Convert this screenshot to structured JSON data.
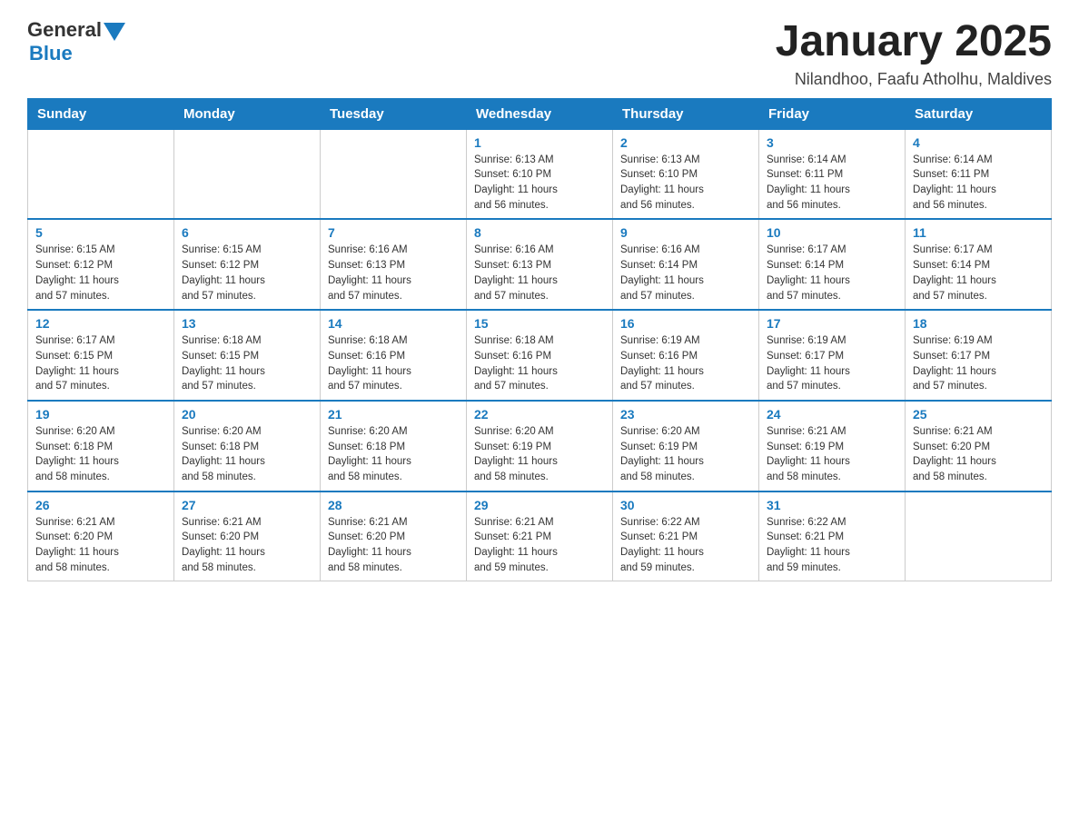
{
  "header": {
    "logo_general": "General",
    "logo_blue": "Blue",
    "month_title": "January 2025",
    "subtitle": "Nilandhoo, Faafu Atholhu, Maldives"
  },
  "days_of_week": [
    "Sunday",
    "Monday",
    "Tuesday",
    "Wednesday",
    "Thursday",
    "Friday",
    "Saturday"
  ],
  "weeks": [
    {
      "days": [
        {
          "num": "",
          "info": ""
        },
        {
          "num": "",
          "info": ""
        },
        {
          "num": "",
          "info": ""
        },
        {
          "num": "1",
          "info": "Sunrise: 6:13 AM\nSunset: 6:10 PM\nDaylight: 11 hours\nand 56 minutes."
        },
        {
          "num": "2",
          "info": "Sunrise: 6:13 AM\nSunset: 6:10 PM\nDaylight: 11 hours\nand 56 minutes."
        },
        {
          "num": "3",
          "info": "Sunrise: 6:14 AM\nSunset: 6:11 PM\nDaylight: 11 hours\nand 56 minutes."
        },
        {
          "num": "4",
          "info": "Sunrise: 6:14 AM\nSunset: 6:11 PM\nDaylight: 11 hours\nand 56 minutes."
        }
      ]
    },
    {
      "days": [
        {
          "num": "5",
          "info": "Sunrise: 6:15 AM\nSunset: 6:12 PM\nDaylight: 11 hours\nand 57 minutes."
        },
        {
          "num": "6",
          "info": "Sunrise: 6:15 AM\nSunset: 6:12 PM\nDaylight: 11 hours\nand 57 minutes."
        },
        {
          "num": "7",
          "info": "Sunrise: 6:16 AM\nSunset: 6:13 PM\nDaylight: 11 hours\nand 57 minutes."
        },
        {
          "num": "8",
          "info": "Sunrise: 6:16 AM\nSunset: 6:13 PM\nDaylight: 11 hours\nand 57 minutes."
        },
        {
          "num": "9",
          "info": "Sunrise: 6:16 AM\nSunset: 6:14 PM\nDaylight: 11 hours\nand 57 minutes."
        },
        {
          "num": "10",
          "info": "Sunrise: 6:17 AM\nSunset: 6:14 PM\nDaylight: 11 hours\nand 57 minutes."
        },
        {
          "num": "11",
          "info": "Sunrise: 6:17 AM\nSunset: 6:14 PM\nDaylight: 11 hours\nand 57 minutes."
        }
      ]
    },
    {
      "days": [
        {
          "num": "12",
          "info": "Sunrise: 6:17 AM\nSunset: 6:15 PM\nDaylight: 11 hours\nand 57 minutes."
        },
        {
          "num": "13",
          "info": "Sunrise: 6:18 AM\nSunset: 6:15 PM\nDaylight: 11 hours\nand 57 minutes."
        },
        {
          "num": "14",
          "info": "Sunrise: 6:18 AM\nSunset: 6:16 PM\nDaylight: 11 hours\nand 57 minutes."
        },
        {
          "num": "15",
          "info": "Sunrise: 6:18 AM\nSunset: 6:16 PM\nDaylight: 11 hours\nand 57 minutes."
        },
        {
          "num": "16",
          "info": "Sunrise: 6:19 AM\nSunset: 6:16 PM\nDaylight: 11 hours\nand 57 minutes."
        },
        {
          "num": "17",
          "info": "Sunrise: 6:19 AM\nSunset: 6:17 PM\nDaylight: 11 hours\nand 57 minutes."
        },
        {
          "num": "18",
          "info": "Sunrise: 6:19 AM\nSunset: 6:17 PM\nDaylight: 11 hours\nand 57 minutes."
        }
      ]
    },
    {
      "days": [
        {
          "num": "19",
          "info": "Sunrise: 6:20 AM\nSunset: 6:18 PM\nDaylight: 11 hours\nand 58 minutes."
        },
        {
          "num": "20",
          "info": "Sunrise: 6:20 AM\nSunset: 6:18 PM\nDaylight: 11 hours\nand 58 minutes."
        },
        {
          "num": "21",
          "info": "Sunrise: 6:20 AM\nSunset: 6:18 PM\nDaylight: 11 hours\nand 58 minutes."
        },
        {
          "num": "22",
          "info": "Sunrise: 6:20 AM\nSunset: 6:19 PM\nDaylight: 11 hours\nand 58 minutes."
        },
        {
          "num": "23",
          "info": "Sunrise: 6:20 AM\nSunset: 6:19 PM\nDaylight: 11 hours\nand 58 minutes."
        },
        {
          "num": "24",
          "info": "Sunrise: 6:21 AM\nSunset: 6:19 PM\nDaylight: 11 hours\nand 58 minutes."
        },
        {
          "num": "25",
          "info": "Sunrise: 6:21 AM\nSunset: 6:20 PM\nDaylight: 11 hours\nand 58 minutes."
        }
      ]
    },
    {
      "days": [
        {
          "num": "26",
          "info": "Sunrise: 6:21 AM\nSunset: 6:20 PM\nDaylight: 11 hours\nand 58 minutes."
        },
        {
          "num": "27",
          "info": "Sunrise: 6:21 AM\nSunset: 6:20 PM\nDaylight: 11 hours\nand 58 minutes."
        },
        {
          "num": "28",
          "info": "Sunrise: 6:21 AM\nSunset: 6:20 PM\nDaylight: 11 hours\nand 58 minutes."
        },
        {
          "num": "29",
          "info": "Sunrise: 6:21 AM\nSunset: 6:21 PM\nDaylight: 11 hours\nand 59 minutes."
        },
        {
          "num": "30",
          "info": "Sunrise: 6:22 AM\nSunset: 6:21 PM\nDaylight: 11 hours\nand 59 minutes."
        },
        {
          "num": "31",
          "info": "Sunrise: 6:22 AM\nSunset: 6:21 PM\nDaylight: 11 hours\nand 59 minutes."
        },
        {
          "num": "",
          "info": ""
        }
      ]
    }
  ]
}
